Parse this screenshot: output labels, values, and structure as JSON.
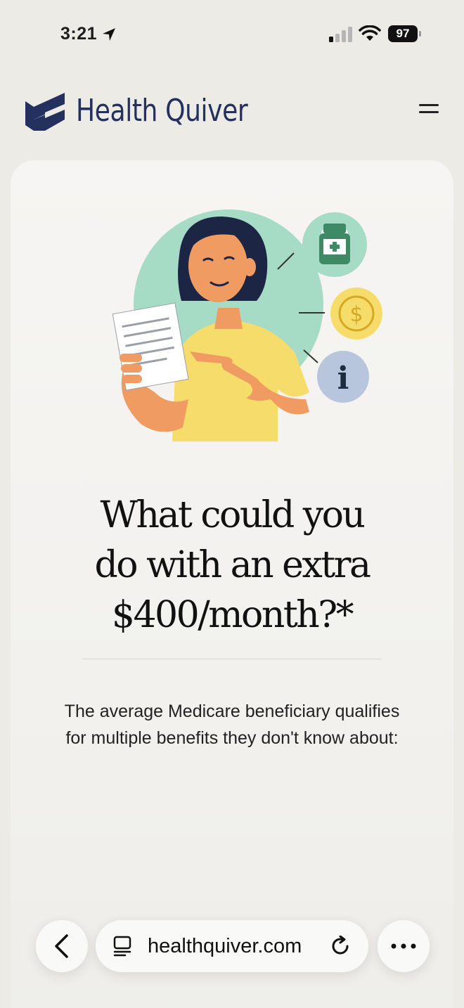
{
  "status_bar": {
    "time": "3:21",
    "battery": "97",
    "icons": [
      "location-arrow-icon",
      "cellular-signal-icon",
      "wifi-icon",
      "battery-icon"
    ]
  },
  "header": {
    "brand": "Health Quiver",
    "logo_icon": "health-quiver-logo-icon",
    "menu_icon": "hamburger-menu-icon",
    "brand_color": "#24305e"
  },
  "hero": {
    "illustration": "woman-reading-document-illustration",
    "headline_lines": [
      "What could you",
      "do with an extra",
      "$400/month?*"
    ],
    "subtext_lines": [
      "The average Medicare beneficiary qualifies",
      "for multiple benefits they don't know about:"
    ]
  },
  "browser": {
    "url": "healthquiver.com",
    "icons": [
      "back-icon",
      "reader-mode-icon",
      "reload-icon",
      "more-icon"
    ]
  },
  "colors": {
    "page_background": "#ecebe6",
    "card_background": "#f6f5f3",
    "illustration_green": "#a6dcc5",
    "illustration_yellow": "#f6dd6b",
    "illustration_blue": "#b8c6dd"
  }
}
